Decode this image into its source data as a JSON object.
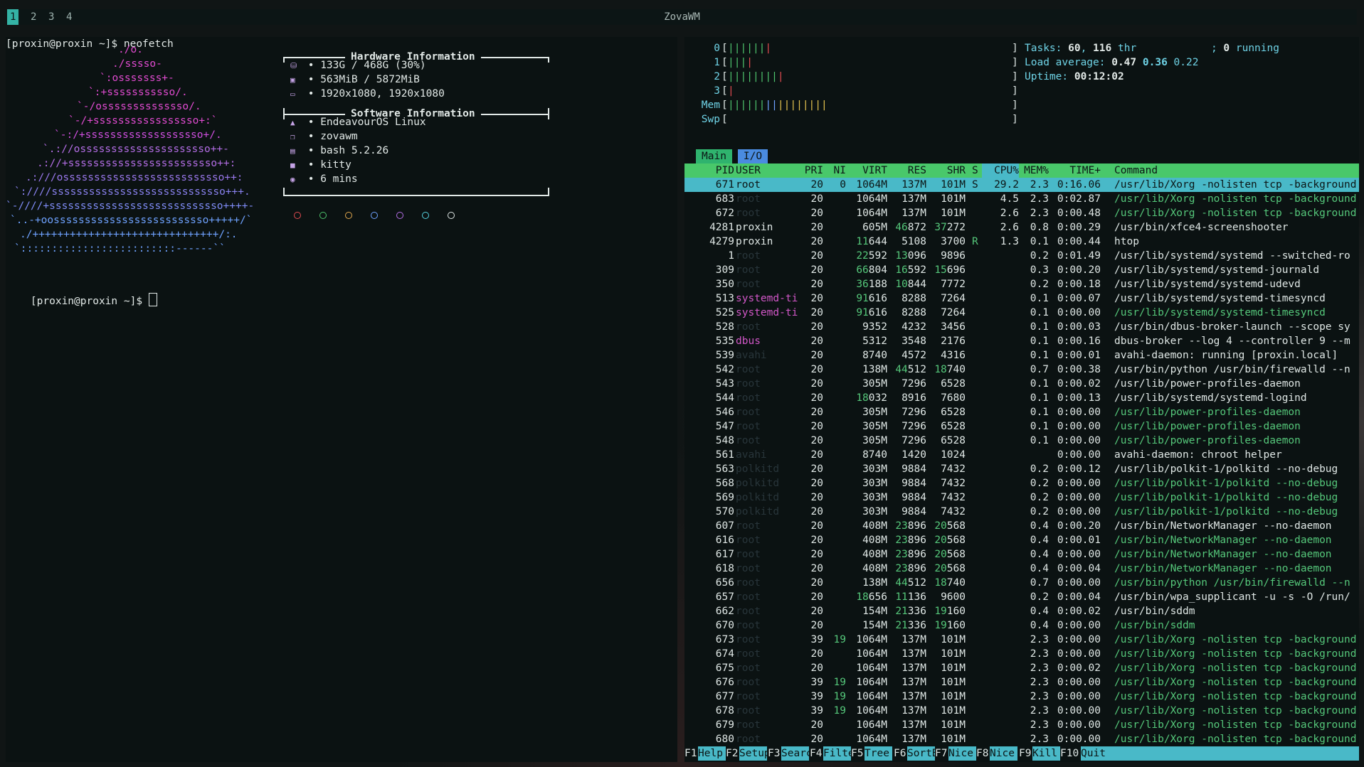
{
  "topbar": {
    "workspaces": [
      "1",
      "2",
      "3",
      "4"
    ],
    "active_workspace": "1",
    "wm_title": "ZovaWM"
  },
  "left_terminal": {
    "command_line": "[proxin@proxin ~]$ neofetch",
    "prompt": "[proxin@proxin ~]$ ",
    "logo": [
      {
        "text": "./o.",
        "color": "#e14bd1"
      },
      {
        "text": "./sssso-",
        "color": "#e14bd1"
      },
      {
        "text": "`:osssssss+-",
        "color": "#e14bd1"
      },
      {
        "text": "`:+sssssssssso/.",
        "color": "#e14bd1"
      },
      {
        "text": "`-/ossssssssssssso/.",
        "color": "#e14bd1"
      },
      {
        "text": "`-/+sssssssssssssssso+:`",
        "color": "#e14bd1"
      },
      {
        "text": "`-:/+sssssssssssssssssso+/.",
        "color": "#d04fe0"
      },
      {
        "text": "`.://osssssssssssssssssssso++-",
        "color": "#b46ee6"
      },
      {
        "text": ".://+ssssssssssssssssssssssso++:",
        "color": "#b46ee6"
      },
      {
        "text": ".:///ossssssssssssssssssssssssso++:",
        "color": "#9a78ec"
      },
      {
        "text": "`:////ssssssssssssssssssssssssssso+++.",
        "color": "#8a82f0"
      },
      {
        "text": "`-////+ssssssssssssssssssssssssssso++++-",
        "color": "#7f8cf6"
      },
      {
        "text": "`..-+oosssssssssssssssssssssssso+++++/`",
        "color": "#6fa2ff"
      },
      {
        "text": "./++++++++++++++++++++++++++++++/:.",
        "color": "#6fa2ff"
      },
      {
        "text": "`:::::::::::::::::::::::::------``",
        "color": "#6fa2ff"
      }
    ],
    "hardware_title": "Hardware Information",
    "hardware": [
      {
        "icon": "disk-icon",
        "value": "133G / 468G (30%)"
      },
      {
        "icon": "memory-icon",
        "value": "563MiB / 5872MiB"
      },
      {
        "icon": "monitor-icon",
        "value": "1920x1080, 1920x1080"
      }
    ],
    "software_title": "Software Information",
    "software": [
      {
        "icon": "distro-icon",
        "value": "EndeavourOS Linux"
      },
      {
        "icon": "window-icon",
        "value": "zovawm"
      },
      {
        "icon": "terminal-icon",
        "value": "bash 5.2.26"
      },
      {
        "icon": "kitty-icon",
        "value": "kitty"
      },
      {
        "icon": "clock-icon",
        "value": "6 mins"
      }
    ],
    "color_dots": [
      "#e04b50",
      "#4ec36c",
      "#e2a84e",
      "#6fa2ff",
      "#b46ee6",
      "#56d2e0",
      "#dfe7e5"
    ]
  },
  "htop": {
    "meters": [
      {
        "label": "0",
        "bars": "|||||||",
        "value": "",
        "colors": [
          "#4ec36c",
          "#4ec36c",
          "#4ec36c",
          "#4ec36c",
          "#4ec36c",
          "#4ec36c",
          "#e04b50"
        ]
      },
      {
        "label": "1",
        "bars": "||||",
        "value": "",
        "colors": [
          "#4ec36c",
          "#4ec36c",
          "#4ec36c",
          "#e04b50"
        ]
      },
      {
        "label": "2",
        "bars": "|||||||||",
        "value": "",
        "colors": [
          "#4ec36c",
          "#4ec36c",
          "#4ec36c",
          "#4ec36c",
          "#4ec36c",
          "#4ec36c",
          "#4ec36c",
          "#4ec36c",
          "#e04b50"
        ]
      },
      {
        "label": "3",
        "bars": "|",
        "value": "",
        "colors": [
          "#e04b50"
        ]
      },
      {
        "label": "Mem",
        "bars": "||||||||||||||||",
        "value": "",
        "colors": [
          "#4ec36c",
          "#4ec36c",
          "#4ec36c",
          "#4ec36c",
          "#4ec36c",
          "#4ec36c",
          "#6fa2ff",
          "#6fa2ff",
          "#e2c14e",
          "#e2c14e",
          "#e2c14e",
          "#e2c14e",
          "#e2c14e",
          "#e2c14e",
          "#e2c14e",
          "#e2c14e"
        ]
      },
      {
        "label": "Swp",
        "bars": "",
        "value": "",
        "colors": []
      }
    ],
    "tasks_label": "Tasks: ",
    "tasks": "60",
    "threads": "116",
    "tasks_thr": " thr",
    "running_label": "; ",
    "running": "0",
    "running_suffix": " running",
    "load_label": "Load average: ",
    "load1": "0.47",
    "load5": "0.36",
    "load15": "0.22",
    "uptime_label": "Uptime: ",
    "uptime": "00:12:02",
    "tabs": [
      "Main",
      "I/O"
    ],
    "columns": {
      "pid": "PID",
      "user": "USER",
      "pri": "PRI",
      "ni": "NI",
      "virt": "VIRT",
      "res": "RES",
      "shr": "SHR",
      "s": "S",
      "cpu": "CPU%",
      "mem": "MEM%",
      "time": "TIME+",
      "command": "Command"
    },
    "processes": [
      {
        "pid": "671",
        "user": "root",
        "pri": "20",
        "ni": "0",
        "virt": "1064M",
        "res": "137M",
        "shr": "101M",
        "s": "S",
        "cpu": "29.2",
        "mem": "2.3",
        "time": "0:16.06",
        "cmd": "/usr/lib/Xorg -nolisten tcp -background",
        "sel": true,
        "uc": "u-white",
        "cc": "white"
      },
      {
        "pid": "683",
        "user": "root",
        "pri": "20",
        "ni": "",
        "virt": "1064M",
        "res": "137M",
        "shr": "101M",
        "s": "",
        "cpu": "4.5",
        "mem": "2.3",
        "time": "0:02.87",
        "cmd": "/usr/lib/Xorg -nolisten tcp -background",
        "uc": "u-dim",
        "cc": "green"
      },
      {
        "pid": "672",
        "user": "root",
        "pri": "20",
        "ni": "",
        "virt": "1064M",
        "res": "137M",
        "shr": "101M",
        "s": "",
        "cpu": "2.6",
        "mem": "2.3",
        "time": "0:00.48",
        "cmd": "/usr/lib/Xorg -nolisten tcp -background",
        "uc": "u-dim",
        "cc": "green"
      },
      {
        "pid": "4281",
        "user": "proxin",
        "pri": "20",
        "ni": "",
        "virt": "605M",
        "res": "46872",
        "shr": "37272",
        "s": "",
        "cpu": "2.6",
        "mem": "0.8",
        "time": "0:00.29",
        "cmd": "/usr/bin/xfce4-screenshooter",
        "uc": "u-white",
        "cc": "white"
      },
      {
        "pid": "4279",
        "user": "proxin",
        "pri": "20",
        "ni": "",
        "virt": "11644",
        "res": "5108",
        "shr": "3700",
        "s": "R",
        "cpu": "1.3",
        "mem": "0.1",
        "time": "0:00.44",
        "cmd": "htop",
        "uc": "u-white",
        "cc": "white"
      },
      {
        "pid": "1",
        "user": "root",
        "pri": "20",
        "ni": "",
        "virt": "22592",
        "res": "13096",
        "shr": "9896",
        "s": "",
        "cpu": "",
        "mem": "0.2",
        "time": "0:01.49",
        "cmd": "/usr/lib/systemd/systemd --switched-ro",
        "uc": "u-dim",
        "cc": "white"
      },
      {
        "pid": "309",
        "user": "root",
        "pri": "20",
        "ni": "",
        "virt": "66804",
        "res": "16592",
        "shr": "15696",
        "s": "",
        "cpu": "",
        "mem": "0.3",
        "time": "0:00.20",
        "cmd": "/usr/lib/systemd/systemd-journald",
        "uc": "u-dim",
        "cc": "white"
      },
      {
        "pid": "350",
        "user": "root",
        "pri": "20",
        "ni": "",
        "virt": "36188",
        "res": "10844",
        "shr": "7772",
        "s": "",
        "cpu": "",
        "mem": "0.2",
        "time": "0:00.18",
        "cmd": "/usr/lib/systemd/systemd-udevd",
        "uc": "u-dim",
        "cc": "white"
      },
      {
        "pid": "513",
        "user": "systemd-ti",
        "pri": "20",
        "ni": "",
        "virt": "91616",
        "res": "8288",
        "shr": "7264",
        "s": "",
        "cpu": "",
        "mem": "0.1",
        "time": "0:00.07",
        "cmd": "/usr/lib/systemd/systemd-timesyncd",
        "uc": "u-mag",
        "cc": "white"
      },
      {
        "pid": "525",
        "user": "systemd-ti",
        "pri": "20",
        "ni": "",
        "virt": "91616",
        "res": "8288",
        "shr": "7264",
        "s": "",
        "cpu": "",
        "mem": "0.1",
        "time": "0:00.00",
        "cmd": "/usr/lib/systemd/systemd-timesyncd",
        "uc": "u-mag",
        "cc": "green"
      },
      {
        "pid": "528",
        "user": "root",
        "pri": "20",
        "ni": "",
        "virt": "9352",
        "res": "4232",
        "shr": "3456",
        "s": "",
        "cpu": "",
        "mem": "0.1",
        "time": "0:00.03",
        "cmd": "/usr/bin/dbus-broker-launch --scope sy",
        "uc": "u-dim",
        "cc": "white"
      },
      {
        "pid": "535",
        "user": "dbus",
        "pri": "20",
        "ni": "",
        "virt": "5312",
        "res": "3548",
        "shr": "2176",
        "s": "",
        "cpu": "",
        "mem": "0.1",
        "time": "0:00.16",
        "cmd": "dbus-broker --log 4 --controller 9 --m",
        "uc": "u-mag",
        "cc": "white"
      },
      {
        "pid": "539",
        "user": "avahi",
        "pri": "20",
        "ni": "",
        "virt": "8740",
        "res": "4572",
        "shr": "4316",
        "s": "",
        "cpu": "",
        "mem": "0.1",
        "time": "0:00.01",
        "cmd": "avahi-daemon: running [proxin.local]",
        "uc": "u-dim",
        "cc": "white"
      },
      {
        "pid": "542",
        "user": "root",
        "pri": "20",
        "ni": "",
        "virt": "138M",
        "res": "44512",
        "shr": "18740",
        "s": "",
        "cpu": "",
        "mem": "0.7",
        "time": "0:00.38",
        "cmd": "/usr/bin/python /usr/bin/firewalld --n",
        "uc": "u-dim",
        "cc": "white"
      },
      {
        "pid": "543",
        "user": "root",
        "pri": "20",
        "ni": "",
        "virt": "305M",
        "res": "7296",
        "shr": "6528",
        "s": "",
        "cpu": "",
        "mem": "0.1",
        "time": "0:00.02",
        "cmd": "/usr/lib/power-profiles-daemon",
        "uc": "u-dim",
        "cc": "white"
      },
      {
        "pid": "544",
        "user": "root",
        "pri": "20",
        "ni": "",
        "virt": "18032",
        "res": "8916",
        "shr": "7680",
        "s": "",
        "cpu": "",
        "mem": "0.1",
        "time": "0:00.13",
        "cmd": "/usr/lib/systemd/systemd-logind",
        "uc": "u-dim",
        "cc": "white"
      },
      {
        "pid": "546",
        "user": "root",
        "pri": "20",
        "ni": "",
        "virt": "305M",
        "res": "7296",
        "shr": "6528",
        "s": "",
        "cpu": "",
        "mem": "0.1",
        "time": "0:00.00",
        "cmd": "/usr/lib/power-profiles-daemon",
        "uc": "u-dim",
        "cc": "green"
      },
      {
        "pid": "547",
        "user": "root",
        "pri": "20",
        "ni": "",
        "virt": "305M",
        "res": "7296",
        "shr": "6528",
        "s": "",
        "cpu": "",
        "mem": "0.1",
        "time": "0:00.00",
        "cmd": "/usr/lib/power-profiles-daemon",
        "uc": "u-dim",
        "cc": "green"
      },
      {
        "pid": "548",
        "user": "root",
        "pri": "20",
        "ni": "",
        "virt": "305M",
        "res": "7296",
        "shr": "6528",
        "s": "",
        "cpu": "",
        "mem": "0.1",
        "time": "0:00.00",
        "cmd": "/usr/lib/power-profiles-daemon",
        "uc": "u-dim",
        "cc": "green"
      },
      {
        "pid": "561",
        "user": "avahi",
        "pri": "20",
        "ni": "",
        "virt": "8740",
        "res": "1420",
        "shr": "1024",
        "s": "",
        "cpu": "",
        "mem": "",
        "time": "0:00.00",
        "cmd": "avahi-daemon: chroot helper",
        "uc": "u-dim",
        "cc": "white"
      },
      {
        "pid": "563",
        "user": "polkitd",
        "pri": "20",
        "ni": "",
        "virt": "303M",
        "res": "9884",
        "shr": "7432",
        "s": "",
        "cpu": "",
        "mem": "0.2",
        "time": "0:00.12",
        "cmd": "/usr/lib/polkit-1/polkitd --no-debug",
        "uc": "u-dim",
        "cc": "white"
      },
      {
        "pid": "568",
        "user": "polkitd",
        "pri": "20",
        "ni": "",
        "virt": "303M",
        "res": "9884",
        "shr": "7432",
        "s": "",
        "cpu": "",
        "mem": "0.2",
        "time": "0:00.00",
        "cmd": "/usr/lib/polkit-1/polkitd --no-debug",
        "uc": "u-dim",
        "cc": "green"
      },
      {
        "pid": "569",
        "user": "polkitd",
        "pri": "20",
        "ni": "",
        "virt": "303M",
        "res": "9884",
        "shr": "7432",
        "s": "",
        "cpu": "",
        "mem": "0.2",
        "time": "0:00.00",
        "cmd": "/usr/lib/polkit-1/polkitd --no-debug",
        "uc": "u-dim",
        "cc": "green"
      },
      {
        "pid": "570",
        "user": "polkitd",
        "pri": "20",
        "ni": "",
        "virt": "303M",
        "res": "9884",
        "shr": "7432",
        "s": "",
        "cpu": "",
        "mem": "0.2",
        "time": "0:00.00",
        "cmd": "/usr/lib/polkit-1/polkitd --no-debug",
        "uc": "u-dim",
        "cc": "green"
      },
      {
        "pid": "607",
        "user": "root",
        "pri": "20",
        "ni": "",
        "virt": "408M",
        "res": "23896",
        "shr": "20568",
        "s": "",
        "cpu": "",
        "mem": "0.4",
        "time": "0:00.20",
        "cmd": "/usr/bin/NetworkManager --no-daemon",
        "uc": "u-dim",
        "cc": "white"
      },
      {
        "pid": "616",
        "user": "root",
        "pri": "20",
        "ni": "",
        "virt": "408M",
        "res": "23896",
        "shr": "20568",
        "s": "",
        "cpu": "",
        "mem": "0.4",
        "time": "0:00.01",
        "cmd": "/usr/bin/NetworkManager --no-daemon",
        "uc": "u-dim",
        "cc": "green"
      },
      {
        "pid": "617",
        "user": "root",
        "pri": "20",
        "ni": "",
        "virt": "408M",
        "res": "23896",
        "shr": "20568",
        "s": "",
        "cpu": "",
        "mem": "0.4",
        "time": "0:00.00",
        "cmd": "/usr/bin/NetworkManager --no-daemon",
        "uc": "u-dim",
        "cc": "green"
      },
      {
        "pid": "618",
        "user": "root",
        "pri": "20",
        "ni": "",
        "virt": "408M",
        "res": "23896",
        "shr": "20568",
        "s": "",
        "cpu": "",
        "mem": "0.4",
        "time": "0:00.04",
        "cmd": "/usr/bin/NetworkManager --no-daemon",
        "uc": "u-dim",
        "cc": "green"
      },
      {
        "pid": "656",
        "user": "root",
        "pri": "20",
        "ni": "",
        "virt": "138M",
        "res": "44512",
        "shr": "18740",
        "s": "",
        "cpu": "",
        "mem": "0.7",
        "time": "0:00.00",
        "cmd": "/usr/bin/python /usr/bin/firewalld --n",
        "uc": "u-dim",
        "cc": "green"
      },
      {
        "pid": "657",
        "user": "root",
        "pri": "20",
        "ni": "",
        "virt": "18656",
        "res": "11136",
        "shr": "9600",
        "s": "",
        "cpu": "",
        "mem": "0.2",
        "time": "0:00.04",
        "cmd": "/usr/bin/wpa_supplicant -u -s -O /run/",
        "uc": "u-dim",
        "cc": "white"
      },
      {
        "pid": "662",
        "user": "root",
        "pri": "20",
        "ni": "",
        "virt": "154M",
        "res": "21336",
        "shr": "19160",
        "s": "",
        "cpu": "",
        "mem": "0.4",
        "time": "0:00.02",
        "cmd": "/usr/bin/sddm",
        "uc": "u-dim",
        "cc": "white"
      },
      {
        "pid": "670",
        "user": "root",
        "pri": "20",
        "ni": "",
        "virt": "154M",
        "res": "21336",
        "shr": "19160",
        "s": "",
        "cpu": "",
        "mem": "0.4",
        "time": "0:00.00",
        "cmd": "/usr/bin/sddm",
        "uc": "u-dim",
        "cc": "green"
      },
      {
        "pid": "673",
        "user": "root",
        "pri": "39",
        "ni": "19",
        "virt": "1064M",
        "res": "137M",
        "shr": "101M",
        "s": "",
        "cpu": "",
        "mem": "2.3",
        "time": "0:00.00",
        "cmd": "/usr/lib/Xorg -nolisten tcp -background",
        "uc": "u-dim",
        "cc": "green"
      },
      {
        "pid": "674",
        "user": "root",
        "pri": "20",
        "ni": "",
        "virt": "1064M",
        "res": "137M",
        "shr": "101M",
        "s": "",
        "cpu": "",
        "mem": "2.3",
        "time": "0:00.00",
        "cmd": "/usr/lib/Xorg -nolisten tcp -background",
        "uc": "u-dim",
        "cc": "green"
      },
      {
        "pid": "675",
        "user": "root",
        "pri": "20",
        "ni": "",
        "virt": "1064M",
        "res": "137M",
        "shr": "101M",
        "s": "",
        "cpu": "",
        "mem": "2.3",
        "time": "0:00.02",
        "cmd": "/usr/lib/Xorg -nolisten tcp -background",
        "uc": "u-dim",
        "cc": "green"
      },
      {
        "pid": "676",
        "user": "root",
        "pri": "39",
        "ni": "19",
        "virt": "1064M",
        "res": "137M",
        "shr": "101M",
        "s": "",
        "cpu": "",
        "mem": "2.3",
        "time": "0:00.00",
        "cmd": "/usr/lib/Xorg -nolisten tcp -background",
        "uc": "u-dim",
        "cc": "green"
      },
      {
        "pid": "677",
        "user": "root",
        "pri": "39",
        "ni": "19",
        "virt": "1064M",
        "res": "137M",
        "shr": "101M",
        "s": "",
        "cpu": "",
        "mem": "2.3",
        "time": "0:00.00",
        "cmd": "/usr/lib/Xorg -nolisten tcp -background",
        "uc": "u-dim",
        "cc": "green"
      },
      {
        "pid": "678",
        "user": "root",
        "pri": "39",
        "ni": "19",
        "virt": "1064M",
        "res": "137M",
        "shr": "101M",
        "s": "",
        "cpu": "",
        "mem": "2.3",
        "time": "0:00.00",
        "cmd": "/usr/lib/Xorg -nolisten tcp -background",
        "uc": "u-dim",
        "cc": "green"
      },
      {
        "pid": "679",
        "user": "root",
        "pri": "20",
        "ni": "",
        "virt": "1064M",
        "res": "137M",
        "shr": "101M",
        "s": "",
        "cpu": "",
        "mem": "2.3",
        "time": "0:00.00",
        "cmd": "/usr/lib/Xorg -nolisten tcp -background",
        "uc": "u-dim",
        "cc": "green"
      },
      {
        "pid": "680",
        "user": "root",
        "pri": "20",
        "ni": "",
        "virt": "1064M",
        "res": "137M",
        "shr": "101M",
        "s": "",
        "cpu": "",
        "mem": "2.3",
        "time": "0:00.00",
        "cmd": "/usr/lib/Xorg -nolisten tcp -background",
        "uc": "u-dim",
        "cc": "green"
      }
    ],
    "footer": [
      {
        "key": "F1",
        "label": "Help"
      },
      {
        "key": "F2",
        "label": "Setup"
      },
      {
        "key": "F3",
        "label": "Search"
      },
      {
        "key": "F4",
        "label": "Filter"
      },
      {
        "key": "F5",
        "label": "Tree"
      },
      {
        "key": "F6",
        "label": "SortBy"
      },
      {
        "key": "F7",
        "label": "Nice -"
      },
      {
        "key": "F8",
        "label": "Nice +"
      },
      {
        "key": "F9",
        "label": "Kill"
      },
      {
        "key": "F10",
        "label": "Quit"
      }
    ]
  }
}
